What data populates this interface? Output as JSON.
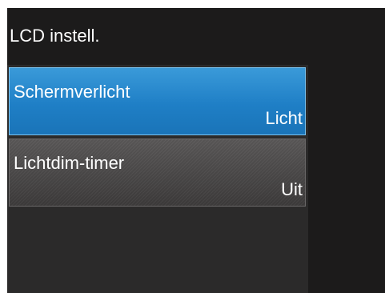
{
  "screen": {
    "title": "LCD instell."
  },
  "menu": {
    "items": [
      {
        "label": "Schermverlicht",
        "value": "Licht",
        "selected": true
      },
      {
        "label": "Lichtdim-timer",
        "value": "Uit",
        "selected": false
      }
    ]
  },
  "colors": {
    "header_background": "#1c1b1b",
    "selected_item": "#1f7fc6",
    "unselected_item": "#474545",
    "text": "#ffffff"
  }
}
